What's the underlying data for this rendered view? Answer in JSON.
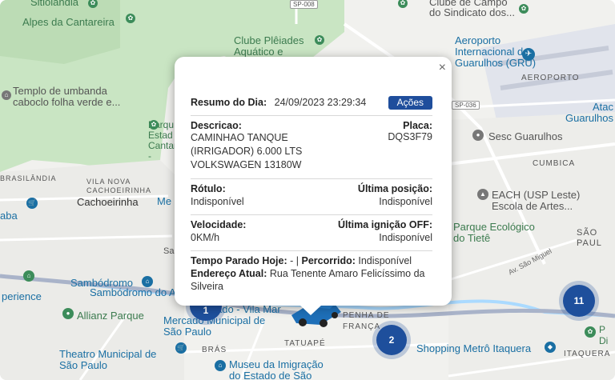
{
  "map": {
    "labels": {
      "sitioalandia": "Sitiolândia",
      "alpes": "Alpes da Cantareira",
      "sp008": "SP-008",
      "sindicato": "do Sindicato dos...",
      "clube": "Clube Plêiades Aquático e Campo",
      "templo": "Templo de umbanda caboclo folha verde e...",
      "aeroporto": "Aeroporto Internacional de Guarulhos (GRU)",
      "aeroporto_bairro": "AEROPORTO",
      "sp036": "SP-036",
      "ataca": "Atac Guarulhos",
      "sesc": "Sesc Guarulhos",
      "cumbica": "CUMBICA",
      "brasilandia": "BRASILÂNDIA",
      "vila_nova": "VILA NOVA CACHOEIRINHA",
      "cachoeirinha": "Cachoeirinha",
      "aba": "aba",
      "each": "EACH (USP Leste) Escola de Artes...",
      "parque_eco": "Parque Ecológico do Tietê",
      "sao_paulo": "SÃO PAUL",
      "av_sao_miguel": "Av. São Miguel",
      "parque_estad": "Parqu Estad Cantar - Núcle",
      "me": "Me",
      "sa": "Sa",
      "sambodromo": "Sambódromo do Anhembi",
      "perience": "perience",
      "allianz": "Allianz Parque",
      "mercado": "Mercado Municipal de São Paulo",
      "vila_mar": "ado - Vila Mar",
      "penha": "PENHA DE FRANÇA",
      "tatuape": "TATUAPÉ",
      "bras": "BRÁS",
      "theatro": "Theatro Municipal de São Paulo",
      "museu": "Museu da Imigração do Estado de São Paulo",
      "shopping": "Shopping Metrô Itaquera",
      "itaquera": "ITAQUERA",
      "pdi": "P Di"
    },
    "clusters": [
      "11",
      "2",
      "1"
    ]
  },
  "popup": {
    "close": "×",
    "resumo_label": "Resumo do Dia:",
    "resumo_datetime": "24/09/2023 23:29:34",
    "acoes_button": "Ações",
    "descricao_label": "Descricao:",
    "descricao_value": "CAMINHAO TANQUE (IRRIGADOR) 6.000 LTS VOLKSWAGEN 13180W",
    "placa_label": "Placa:",
    "placa_value": "DQS3F79",
    "rotulo_label": "Rótulo:",
    "rotulo_value": "Indisponível",
    "ultima_posicao_label": "Última posição:",
    "ultima_posicao_value": "Indisponível",
    "velocidade_label": "Velocidade:",
    "velocidade_value": "0KM/h",
    "ultima_ignicao_label": "Última ignição OFF:",
    "ultima_ignicao_value": "Indisponível",
    "tempo_parado_label": "Tempo Parado Hoje:",
    "tempo_parado_value": "-",
    "separator": "|",
    "percorrido_label": "Percorrido:",
    "percorrido_value": "Indisponível",
    "endereco_label": "Endereço Atual:",
    "endereco_value": "Rua Tenente Amaro Felicíssimo da Silveira"
  },
  "colors": {
    "accent": "#1f4e9c",
    "park": "#c8e6c2",
    "road_major": "#a9b3c9",
    "road_minor": "#ffffff",
    "airport": "#dfe3ee",
    "water": "#aadaff"
  }
}
